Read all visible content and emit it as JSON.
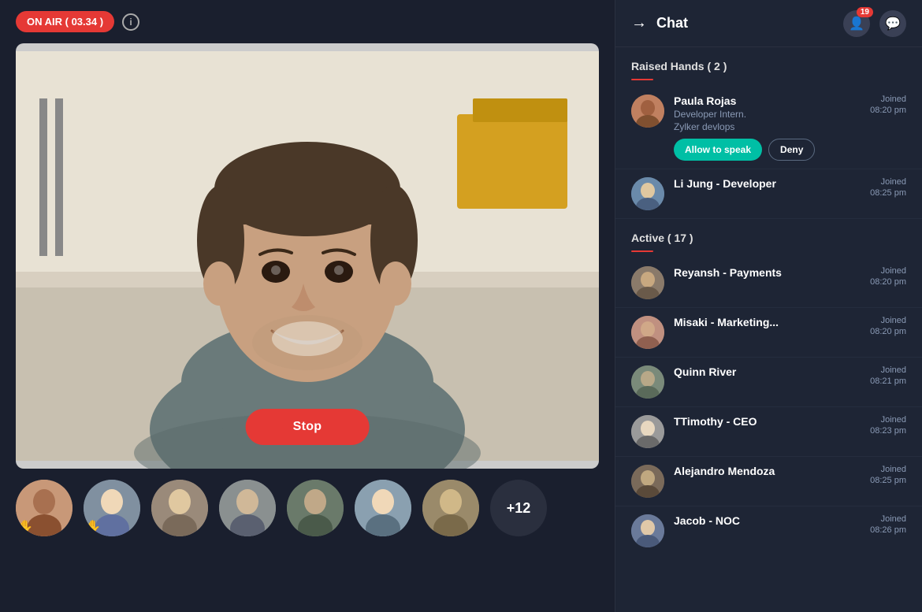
{
  "on_air": {
    "label": "ON AIR",
    "timer": "03.34",
    "badge": "ON AIR ( 03.34 )"
  },
  "stop_button": "Stop",
  "more_count": "+12",
  "chat_header": {
    "title": "Chat",
    "badge_count": "19"
  },
  "raised_hands": {
    "section_label": "Raised Hands ( 2 )",
    "members": [
      {
        "name": "Paula Rojas",
        "sub1": "Developer Intern.",
        "sub2": "Zylker devlops",
        "joined_label": "Joined",
        "time": "08:20 pm",
        "allow_label": "Allow to speak",
        "deny_label": "Deny",
        "avatar_class": "av-paula"
      },
      {
        "name": "Li Jung - Developer",
        "sub1": "",
        "sub2": "",
        "joined_label": "Joined",
        "time": "08:25 pm",
        "avatar_class": "av-li"
      }
    ]
  },
  "active": {
    "section_label": "Active  ( 17 )",
    "members": [
      {
        "name": "Reyansh - Payments",
        "joined_label": "Joined",
        "time": "08:20 pm",
        "avatar_class": "av-reyansh"
      },
      {
        "name": "Misaki - Marketing...",
        "joined_label": "Joined",
        "time": "08:20 pm",
        "avatar_class": "av-misaki"
      },
      {
        "name": "Quinn River",
        "joined_label": "Joined",
        "time": "08:21 pm",
        "avatar_class": "av-quinn"
      },
      {
        "name": "TTimothy - CEO",
        "joined_label": "Joined",
        "time": "08:23 pm",
        "avatar_class": "av-timothy"
      },
      {
        "name": "Alejandro Mendoza",
        "joined_label": "Joined",
        "time": "08:25 pm",
        "avatar_class": "av-alejandro"
      },
      {
        "name": "Jacob - NOC",
        "joined_label": "Joined",
        "time": "08:26 pm",
        "avatar_class": "av-jacob"
      }
    ]
  }
}
